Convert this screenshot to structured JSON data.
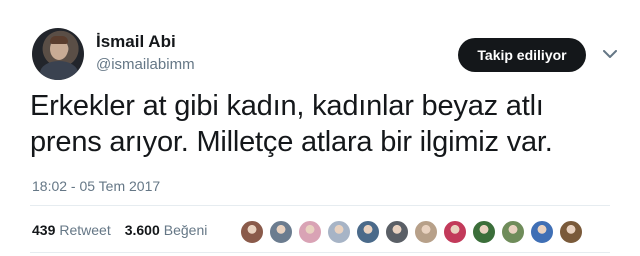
{
  "user": {
    "name": "İsmail Abi",
    "handle": "@ismailabimm"
  },
  "follow_button": {
    "label": "Takip ediliyor"
  },
  "tweet": {
    "line1": "Erkekler at gibi kadın, kadınlar beyaz atlı",
    "line2": "prens arıyor. Milletçe atlara bir ilgimiz var.",
    "timestamp": "18:02 - 05 Tem 2017"
  },
  "stats": {
    "retweets_count": "439",
    "retweets_label": "Retweet",
    "likes_count": "3.600",
    "likes_label": "Beğeni"
  },
  "likers": [
    {
      "icon": "liker-avatar",
      "color": "#8a5a4a"
    },
    {
      "icon": "liker-avatar",
      "color": "#6b7c8f"
    },
    {
      "icon": "liker-avatar",
      "color": "#d9a3b5"
    },
    {
      "icon": "liker-avatar",
      "color": "#a7b4c6"
    },
    {
      "icon": "liker-avatar",
      "color": "#4a6a8a"
    },
    {
      "icon": "liker-avatar",
      "color": "#5a5f66"
    },
    {
      "icon": "liker-avatar",
      "color": "#b7a089"
    },
    {
      "icon": "liker-avatar",
      "color": "#c23a5a"
    },
    {
      "icon": "liker-avatar",
      "color": "#3b6e3a"
    },
    {
      "icon": "liker-avatar",
      "color": "#6f8c5a"
    },
    {
      "icon": "liker-avatar",
      "color": "#3f6fb5"
    },
    {
      "icon": "liker-avatar",
      "color": "#7a5a3a"
    }
  ],
  "colors": {
    "text": "#14171a",
    "muted": "#657786",
    "button_bg": "#14171a"
  }
}
